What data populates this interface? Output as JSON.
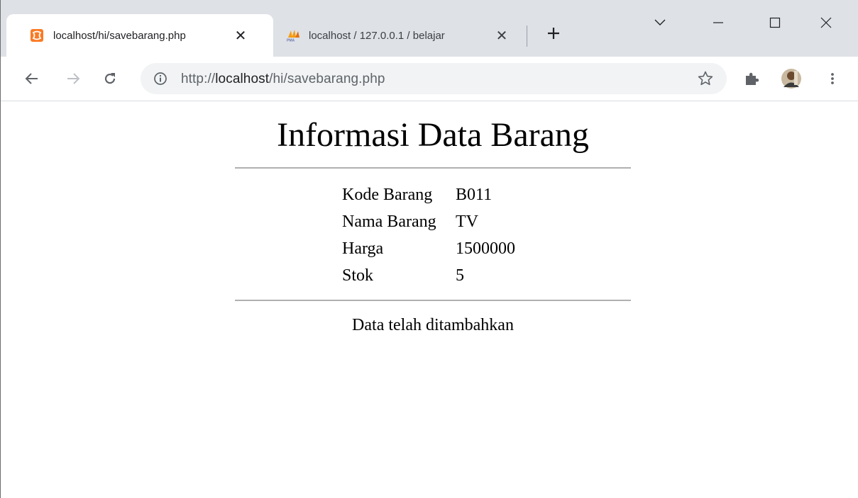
{
  "browser": {
    "tabs": [
      {
        "title": "localhost/hi/savebarang.php",
        "active": true,
        "favicon": "xampp-icon"
      },
      {
        "title": "localhost / 127.0.0.1 / belajar",
        "active": false,
        "favicon": "phpmyadmin-icon"
      }
    ],
    "address_bar": {
      "scheme": "http://",
      "host": "localhost",
      "path": "/hi/savebarang.php"
    },
    "colors": {
      "tabstrip": "#dee1e6",
      "omnibox": "#f1f3f4",
      "xampp_orange": "#fb7a24"
    }
  },
  "page": {
    "heading": "Informasi Data Barang",
    "fields": [
      {
        "label": "Kode Barang",
        "value": "B011"
      },
      {
        "label": "Nama Barang",
        "value": "TV"
      },
      {
        "label": "Harga",
        "value": "1500000"
      },
      {
        "label": "Stok",
        "value": "5"
      }
    ],
    "message": "Data telah ditambahkan"
  }
}
